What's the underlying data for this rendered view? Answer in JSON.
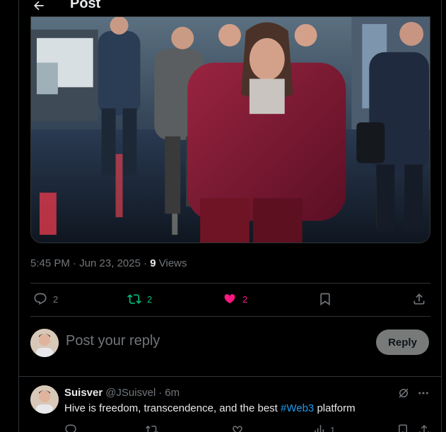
{
  "header": {
    "title": "Post"
  },
  "post": {
    "time": "5:45 PM · Jun 23, 2025 · ",
    "views_count": "9",
    "views_label": " Views",
    "stats": {
      "replies": "2",
      "reposts": "2",
      "likes": "2"
    }
  },
  "composer": {
    "placeholder": "Post your reply",
    "reply_label": "Reply"
  },
  "reply": {
    "name": "Suisver",
    "handle": "@JSuisvel",
    "separator": "·",
    "time": "6m",
    "text_before": "Hive is freedom, transcendence, and the best ",
    "hashtag": "#Web3",
    "text_after": " platform",
    "views": "1"
  },
  "colors": {
    "repost": "#00ba7c",
    "like": "#f91880",
    "link": "#1d9bf0",
    "muted": "#71767b"
  },
  "icons": [
    "back-arrow-icon",
    "reply-icon",
    "repost-icon",
    "heart-icon",
    "bookmark-icon",
    "share-icon",
    "grok-icon",
    "more-icon",
    "views-icon"
  ]
}
